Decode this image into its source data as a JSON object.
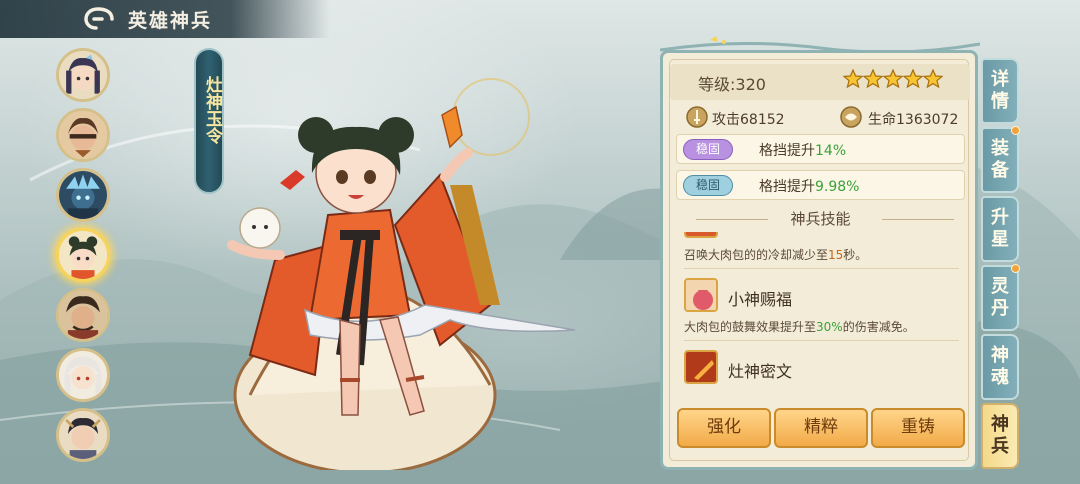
{
  "header": {
    "title": "英雄神兵"
  },
  "weapon": {
    "name": "灶神玉令"
  },
  "heroes": [
    {
      "name": "hero-1"
    },
    {
      "name": "hero-2"
    },
    {
      "name": "hero-3"
    },
    {
      "name": "hero-4",
      "selected": true
    },
    {
      "name": "hero-5"
    },
    {
      "name": "hero-6"
    },
    {
      "name": "hero-7"
    }
  ],
  "info": {
    "level_label": "等级:320",
    "stars": 5,
    "attack": "攻击68152",
    "hp": "生命1363072",
    "attrs": [
      {
        "tag": "稳固",
        "desc_prefix": "格挡提升",
        "value": "14%",
        "tag_color": "purple"
      },
      {
        "tag": "稳固",
        "desc_prefix": "格挡提升",
        "value": "9.98%",
        "tag_color": "blue"
      }
    ],
    "skills_title": "神兵技能",
    "skills": [
      {
        "name": "",
        "desc_prefix": "召唤大肉包的的冷却减少至",
        "desc_value": "15",
        "desc_suffix": "秒。"
      },
      {
        "name": "小神赐福",
        "desc_prefix": "大肉包的鼓舞效果提升至",
        "desc_value": "30%",
        "desc_suffix": "的伤害减免。"
      },
      {
        "name": "灶神密文",
        "desc_prefix": "",
        "desc_value": "",
        "desc_suffix": ""
      }
    ]
  },
  "buttons": {
    "enhance": "强化",
    "refine": "精粹",
    "recast": "重铸"
  },
  "tabs": [
    {
      "label": "详情",
      "active": false,
      "dot": false
    },
    {
      "label": "装备",
      "active": false,
      "dot": true
    },
    {
      "label": "升星",
      "active": false,
      "dot": false
    },
    {
      "label": "灵丹",
      "active": false,
      "dot": true
    },
    {
      "label": "神魂",
      "active": false,
      "dot": false
    },
    {
      "label": "神兵",
      "active": true,
      "dot": false
    }
  ],
  "colors": {
    "accent": "#f2aa48",
    "panel": "#f3ecd8",
    "tab": "#82afb9",
    "highlight_green": "#3aa23a"
  }
}
